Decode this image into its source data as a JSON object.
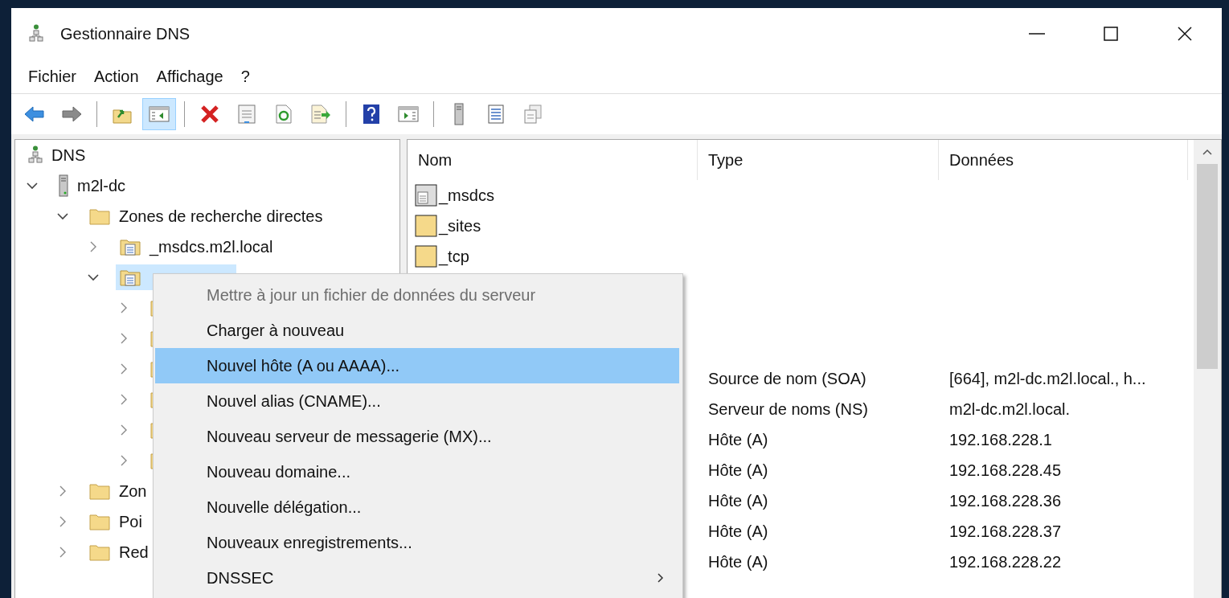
{
  "window": {
    "title": "Gestionnaire DNS"
  },
  "menu_bar": [
    "Fichier",
    "Action",
    "Affichage",
    "?"
  ],
  "toolbar": {
    "groups": [
      [
        {
          "pressed": false
        },
        {
          "pressed": false
        }
      ],
      [
        {
          "pressed": false
        },
        {
          "pressed": true
        }
      ],
      [
        {
          "pressed": false
        },
        {
          "pressed": false
        },
        {
          "pressed": false
        },
        {
          "pressed": false
        }
      ],
      [
        {
          "pressed": false
        },
        {
          "pressed": false
        }
      ],
      [
        {
          "pressed": false
        },
        {
          "pressed": false
        },
        {
          "pressed": false
        }
      ]
    ]
  },
  "tree": [
    {
      "label": "DNS",
      "selected": false,
      "children": [
        {
          "label": "m2l-dc",
          "expanded": true,
          "selected": false,
          "children": [
            {
              "label": "Zones de recherche directes",
              "expanded": true,
              "selected": false,
              "children": [
                {
                  "label": "_msdcs.m2l.local",
                  "expanded": false,
                  "selected": false
                },
                {
                  "expanded": true,
                  "selected": true,
                  "children": [
                    {
                      "expanded": false,
                      "selected": false
                    },
                    {
                      "expanded": false,
                      "selected": false
                    },
                    {
                      "expanded": false,
                      "selected": false
                    },
                    {
                      "expanded": false,
                      "selected": false
                    },
                    {
                      "expanded": false,
                      "selected": false
                    },
                    {
                      "expanded": false,
                      "selected": false
                    }
                  ]
                }
              ]
            },
            {
              "label": "Zon",
              "expanded": false,
              "selected": false
            },
            {
              "label": "Poi",
              "expanded": false,
              "selected": false
            },
            {
              "label": "Red",
              "expanded": false,
              "selected": false
            }
          ]
        }
      ]
    }
  ],
  "list": {
    "columns": [
      "Nom",
      "Type",
      "Données"
    ],
    "folders": [
      {
        "name": "_msdcs",
        "kind": "delegation"
      },
      {
        "name": "_sites",
        "kind": "folder"
      },
      {
        "name": "_tcp",
        "kind": "folder"
      }
    ],
    "records": [
      {
        "type": "Source de nom (SOA)",
        "data": "[664], m2l-dc.m2l.local., h..."
      },
      {
        "type": "Serveur de noms (NS)",
        "data": "m2l-dc.m2l.local."
      },
      {
        "type": "Hôte (A)",
        "data": "192.168.228.1"
      },
      {
        "type": "Hôte (A)",
        "data": "192.168.228.45"
      },
      {
        "type": "Hôte (A)",
        "data": "192.168.228.36"
      },
      {
        "type": "Hôte (A)",
        "data": "192.168.228.37"
      },
      {
        "type": "Hôte (A)",
        "data": "192.168.228.22"
      }
    ]
  },
  "context_menu": [
    {
      "label": "Mettre à jour un fichier de données du serveur",
      "disabled": true,
      "selected": false,
      "submenu": false
    },
    {
      "label": "Charger à nouveau",
      "disabled": false,
      "selected": false,
      "submenu": false
    },
    {
      "label": "Nouvel hôte (A ou AAAA)...",
      "disabled": false,
      "selected": true,
      "submenu": false
    },
    {
      "label": "Nouvel alias (CNAME)...",
      "disabled": false,
      "selected": false,
      "submenu": false
    },
    {
      "label": "Nouveau serveur de messagerie (MX)...",
      "disabled": false,
      "selected": false,
      "submenu": false
    },
    {
      "label": "Nouveau domaine...",
      "disabled": false,
      "selected": false,
      "submenu": false
    },
    {
      "label": "Nouvelle délégation...",
      "disabled": false,
      "selected": false,
      "submenu": false
    },
    {
      "label": "Nouveaux enregistrements...",
      "disabled": false,
      "selected": false,
      "submenu": false
    },
    {
      "label": "DNSSEC",
      "disabled": false,
      "selected": false,
      "submenu": true
    }
  ]
}
